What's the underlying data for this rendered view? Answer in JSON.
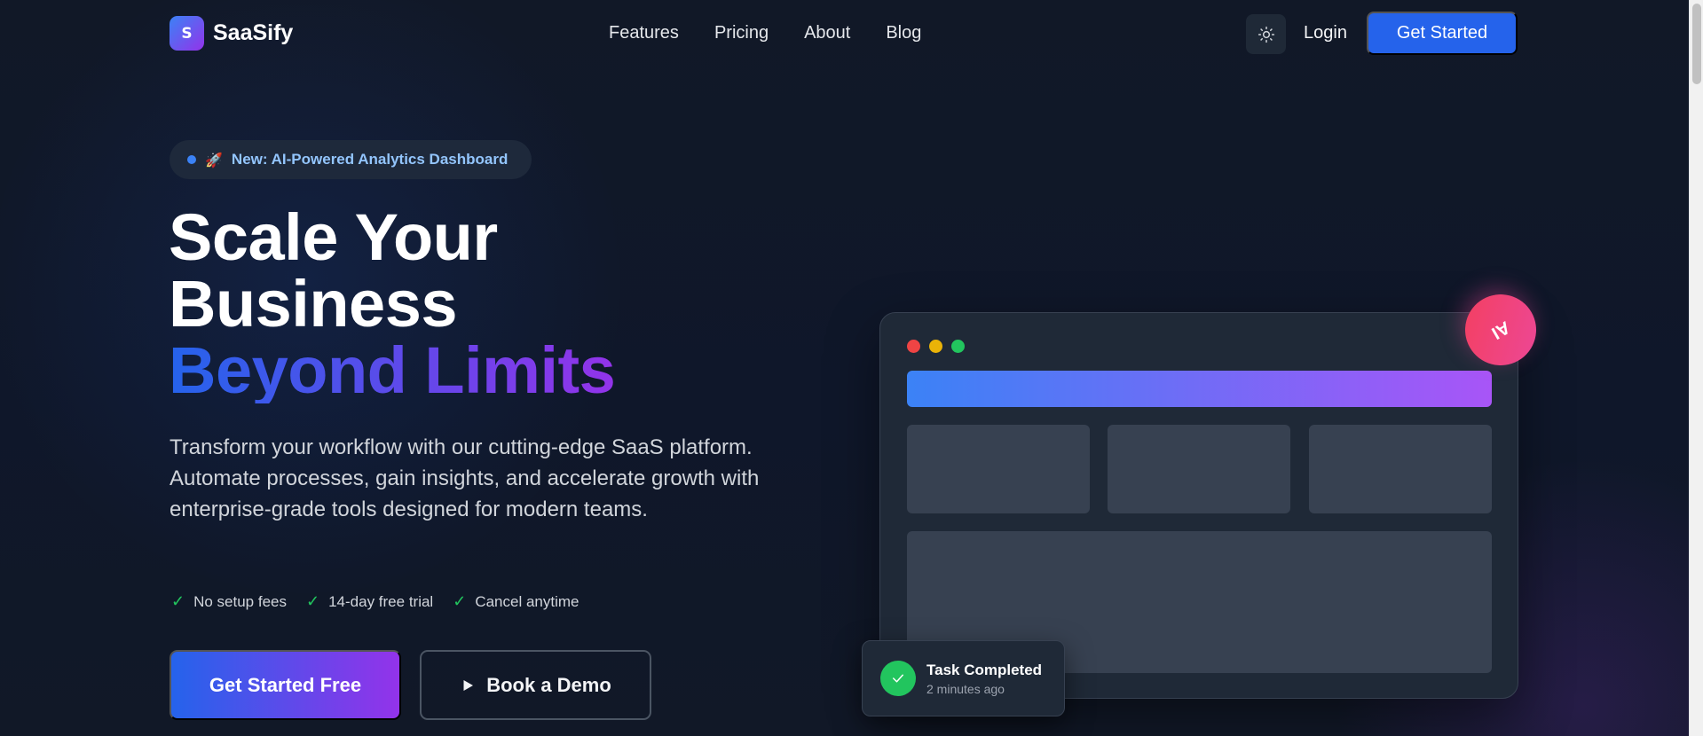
{
  "brand": {
    "logo_letter": "S",
    "name": "SaaSify"
  },
  "nav": {
    "links": [
      "Features",
      "Pricing",
      "About",
      "Blog"
    ],
    "theme_toggle_icon": "sun-icon",
    "login_label": "Login",
    "cta_label": "Get Started"
  },
  "hero": {
    "badge_emoji": "🚀",
    "badge_text": "New: AI-Powered Analytics Dashboard",
    "headline_line1": "Scale Your",
    "headline_line2": "Business",
    "headline_line3": "Beyond Limits",
    "subtext": "Transform your workflow with our cutting-edge SaaS platform. Automate processes, gain insights, and accelerate growth with enterprise-grade tools designed for modern teams.",
    "features": [
      "No setup fees",
      "14-day free trial",
      "Cancel anytime"
    ],
    "primary_cta": "Get Started Free",
    "secondary_cta": "Book a Demo"
  },
  "mockup": {
    "ai_badge": "AI",
    "toast_title": "Task Completed",
    "toast_subtitle": "2 minutes ago"
  },
  "colors": {
    "background": "#111827",
    "accent_blue": "#2563eb",
    "accent_purple": "#9333ea",
    "success": "#22c55e",
    "pink": "#ec4899",
    "window_dot_red": "#ef4444",
    "window_dot_yellow": "#eab308",
    "window_dot_green": "#22c55e"
  }
}
